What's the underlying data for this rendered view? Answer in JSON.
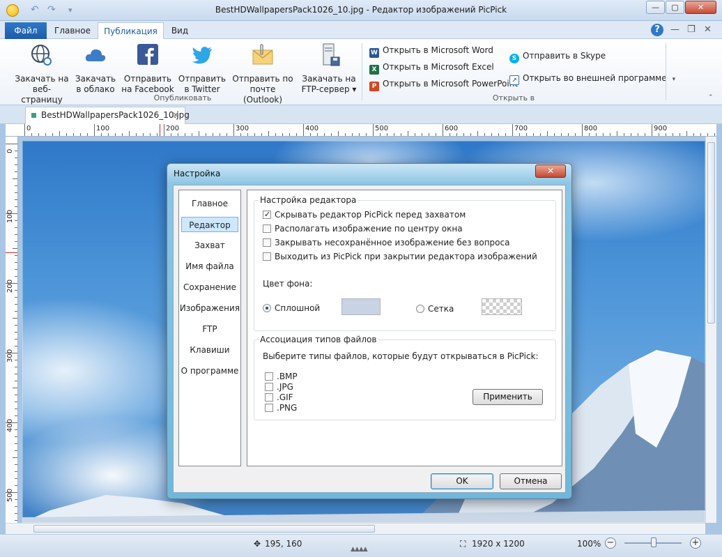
{
  "window": {
    "title": "BestHDWallpapersPack1026_10.jpg - Редактор изображений PicPick",
    "quick_access": [
      "↶",
      "↷",
      "▾"
    ],
    "controls": [
      "—",
      "▢",
      "✕"
    ]
  },
  "ribbon_tabs": {
    "file": "Файл",
    "tabs": [
      "Главное",
      "Публикация",
      "Вид"
    ],
    "active": "Публикация",
    "help": "?"
  },
  "ribbon": {
    "publish_buttons": [
      {
        "line1": "Закачать на",
        "line2": "веб-страницу",
        "icon": "globe-link-icon"
      },
      {
        "line1": "Закачать",
        "line2": "в облако",
        "icon": "cloud-icon"
      },
      {
        "line1": "Отправить",
        "line2": "на Facebook",
        "icon": "facebook-icon"
      },
      {
        "line1": "Отправить",
        "line2": "в Twitter",
        "icon": "twitter-icon"
      },
      {
        "line1": "Отправить по",
        "line2": "почте (Outlook)",
        "icon": "mail-icon"
      },
      {
        "line1": "Закачать на",
        "line2": "FTP-сервер ▾",
        "icon": "ftp-server-icon"
      }
    ],
    "publish_group_label": "Опубликовать",
    "open_in_items": [
      "Открыть в Microsoft Word",
      "Открыть в Microsoft Excel",
      "Открыть в Microsoft PowerPoint",
      "Отправить в Skype",
      "Открыть во внешней программе"
    ],
    "open_in_group_label": "Открыть в"
  },
  "document_tab": {
    "name": "BestHDWallpapersPack1026_10.jpg",
    "close": "✕"
  },
  "ruler": {
    "h_labels": [
      "0",
      "100",
      "200",
      "300",
      "400",
      "500",
      "600",
      "700",
      "800",
      "900"
    ],
    "v_labels": [
      "0",
      "100",
      "200",
      "300",
      "400",
      "500"
    ]
  },
  "statusbar": {
    "cursor_pos": "195, 160",
    "image_size": "1920 x 1200",
    "zoom": "100%",
    "zoom_level": 0.5
  },
  "dialog": {
    "title": "Настройка",
    "close": "✕",
    "nav": [
      "Главное",
      "Редактор",
      "Захват",
      "Имя файла",
      "Сохранение",
      "Изображения",
      "FTP",
      "Клавиши",
      "О программе"
    ],
    "nav_selected": "Редактор",
    "editor_group": "Настройка редактора",
    "options": [
      {
        "label": "Скрывать редактор PicPick перед захватом",
        "checked": true
      },
      {
        "label": "Располагать изображение по центру окна",
        "checked": false
      },
      {
        "label": "Закрывать несохранённое изображение без вопроса",
        "checked": false
      },
      {
        "label": "Выходить из PicPick при закрытии редактора изображений",
        "checked": false
      }
    ],
    "bg_label": "Цвет фона:",
    "bg_solid": "Сплошной",
    "bg_grid": "Сетка",
    "bg_selected": "Сплошной",
    "solid_color": "#c8d3e6",
    "assoc_group": "Ассоциация типов файлов",
    "assoc_text": "Выберите типы файлов, которые будут открываться в PicPick:",
    "file_types": [
      ".BMP",
      ".JPG",
      ".GIF",
      ".PNG"
    ],
    "apply": "Применить",
    "ok": "OK",
    "cancel": "Отмена"
  }
}
